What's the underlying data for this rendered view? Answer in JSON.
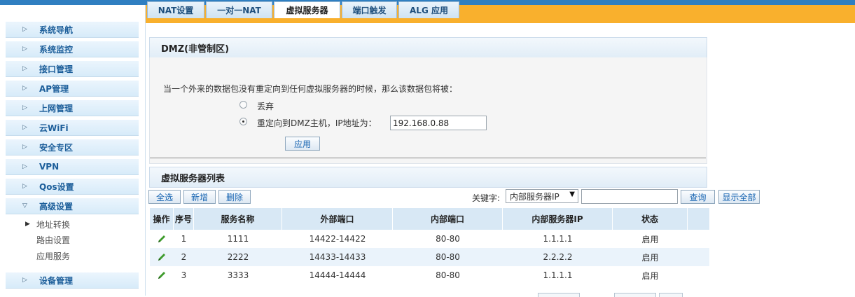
{
  "sidebar": {
    "items": [
      {
        "label": "系统导航"
      },
      {
        "label": "系统监控"
      },
      {
        "label": "接口管理"
      },
      {
        "label": "AP管理"
      },
      {
        "label": "上网管理"
      },
      {
        "label": "云WiFi"
      },
      {
        "label": "安全专区"
      },
      {
        "label": "VPN"
      },
      {
        "label": "Qos设置"
      },
      {
        "label": "高级设置"
      },
      {
        "label": "设备管理"
      }
    ],
    "subitems": [
      {
        "label": "地址转换"
      },
      {
        "label": "路由设置"
      },
      {
        "label": "应用服务"
      }
    ]
  },
  "tabs": [
    {
      "label": "NAT设置"
    },
    {
      "label": "一对一NAT"
    },
    {
      "label": "虚拟服务器"
    },
    {
      "label": "端口触发"
    },
    {
      "label": "ALG 应用"
    }
  ],
  "dmz": {
    "title": "DMZ(非管制区)",
    "description": "当一个外来的数据包没有重定向到任何虚拟服务器的时候，那么该数据包将被：",
    "option_drop": "丢弃",
    "option_redirect": "重定向到DMZ主机，IP地址为：",
    "ip_value": "192.168.0.88",
    "apply_label": "应用"
  },
  "vs_list": {
    "title": "虚拟服务器列表",
    "select_all": "全选",
    "add": "新增",
    "delete": "删除",
    "keyword_label": "关键字:",
    "keyword_selected": "内部服务器IP",
    "search": "查询",
    "show_all": "显示全部",
    "headers": [
      "操作",
      "序号",
      "服务名称",
      "外部端口",
      "内部端口",
      "内部服务器IP",
      "状态"
    ],
    "rows": [
      {
        "index": "1",
        "name": "1111",
        "ext_port": "14422-14422",
        "int_port": "80-80",
        "ip": "1.1.1.1",
        "status": "启用"
      },
      {
        "index": "2",
        "name": "2222",
        "ext_port": "14433-14433",
        "int_port": "80-80",
        "ip": "2.2.2.2",
        "status": "启用"
      },
      {
        "index": "3",
        "name": "3333",
        "ext_port": "14444-14444",
        "int_port": "80-80",
        "ip": "1.1.1.1",
        "status": "启用"
      }
    ]
  },
  "colors": {
    "accent_orange": "#f9b02d",
    "nav_blue": "#1c5e9a",
    "edit_green": "#3e9b2c"
  }
}
